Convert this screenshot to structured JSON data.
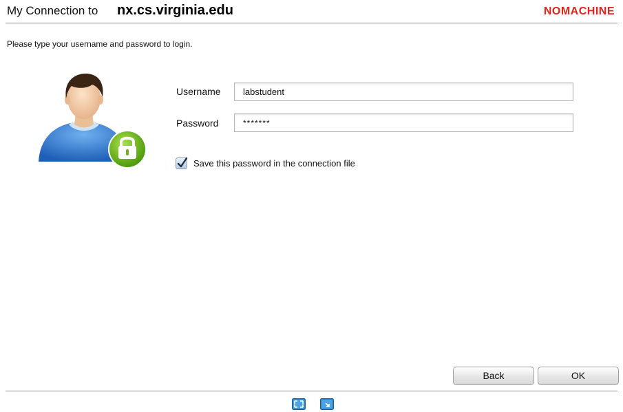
{
  "header": {
    "title_prefix": "My Connection to",
    "host": "nx.cs.virginia.edu",
    "brand": "NOMACHINE"
  },
  "login": {
    "instruction": "Please type your username and password to login.",
    "avatar_icon": "user-lock-icon",
    "username_label": "Username",
    "username_value": "labstudent",
    "password_label": "Password",
    "password_value": "*******",
    "save_password_label": "Save this password in the connection file",
    "save_password_checked": true
  },
  "buttons": {
    "back": "Back",
    "ok": "OK"
  },
  "footer": {
    "icons": [
      "fullscreen-icon",
      "window-mode-icon"
    ]
  },
  "colors": {
    "brand": "#e2231a",
    "lock_green": "#7dc21e",
    "avatar_shirt": "#3b86d8"
  }
}
